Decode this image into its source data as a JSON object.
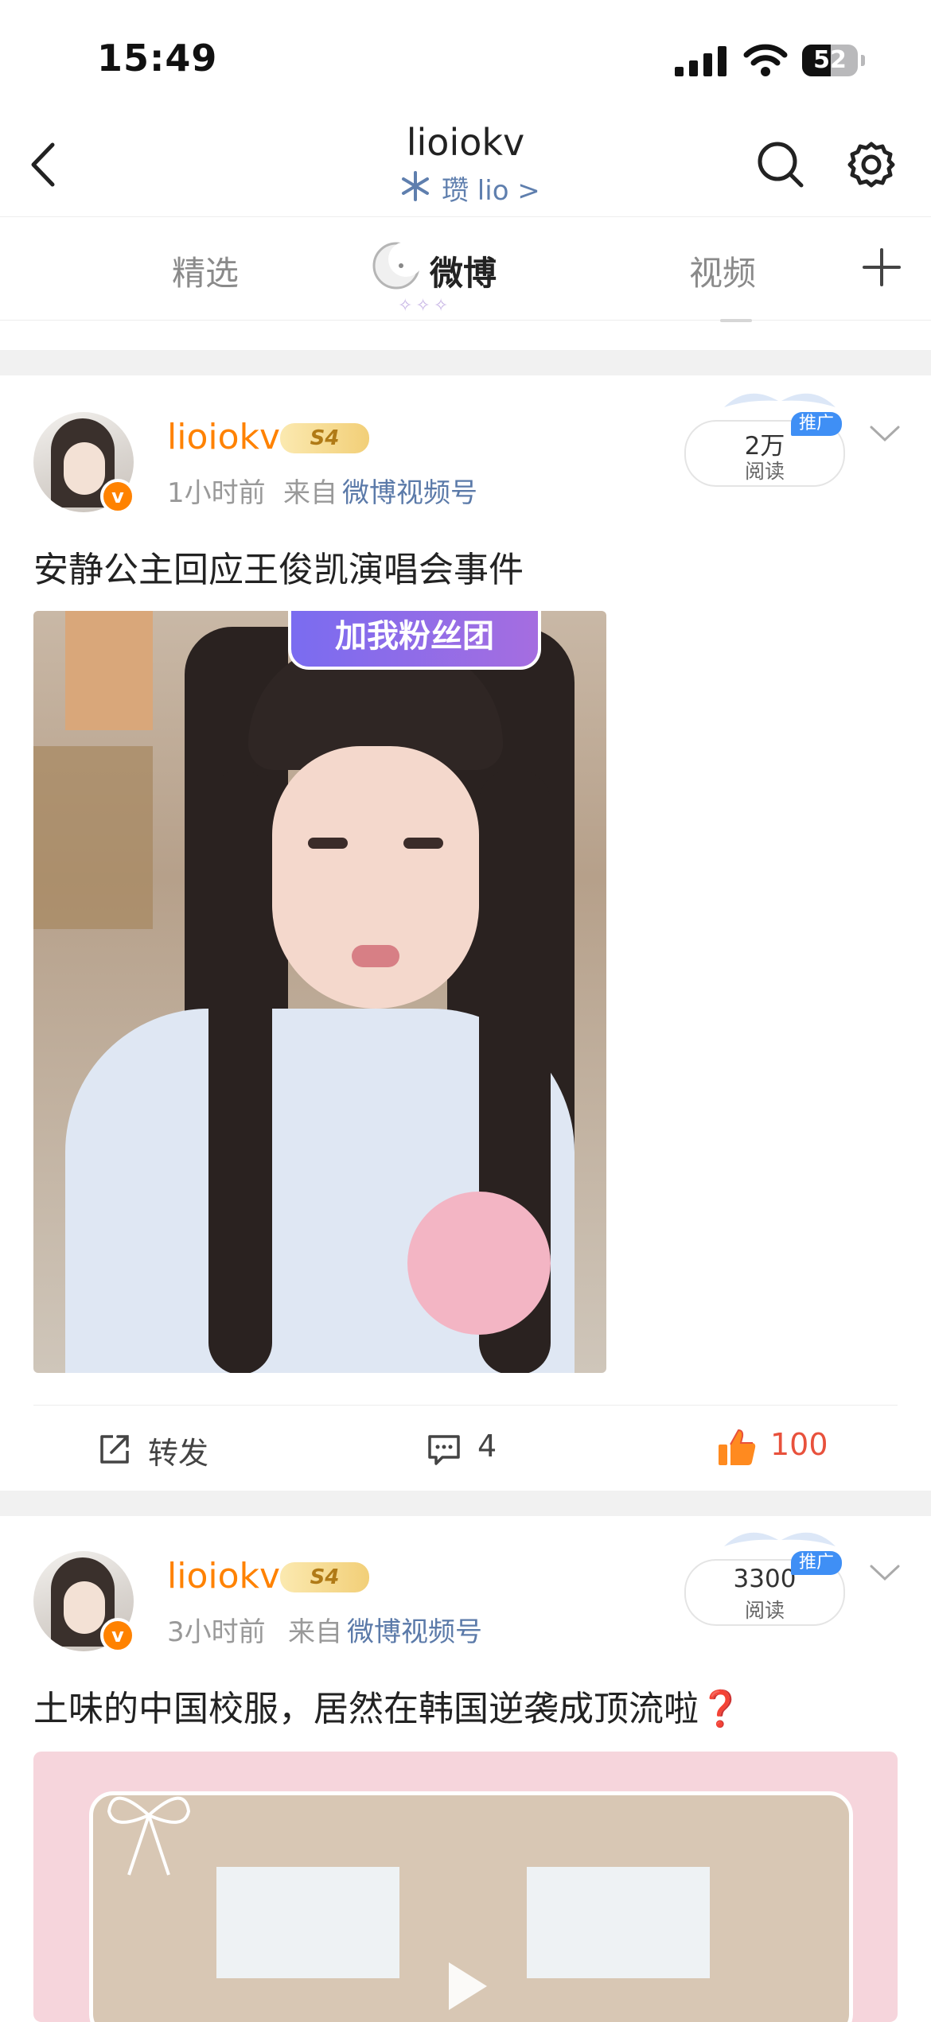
{
  "status_bar": {
    "time": "15:49",
    "battery": "52",
    "battery_level": 0.52
  },
  "header": {
    "title": "lioiokv",
    "subtitle": "瓒 lio >"
  },
  "tabs": [
    {
      "label": "精选",
      "active": false
    },
    {
      "label": "微博",
      "active": true
    },
    {
      "label": "视频",
      "active": false
    }
  ],
  "posts": [
    {
      "username": "lioiokv",
      "level_badge": "S4",
      "time": "1小时前",
      "source_prefix": "来自",
      "source_link": "微博视频号",
      "read_count": "2万",
      "read_label": "阅读",
      "promo_badge": "推广",
      "text": "安静公主回应王俊凯演唱会事件",
      "media_overlay_text": "加我粉丝团",
      "actions": {
        "repost": "转发",
        "comments": "4",
        "likes": "100"
      }
    },
    {
      "username": "lioiokv",
      "level_badge": "S4",
      "time": "3小时前",
      "source_prefix": "来自",
      "source_link": "微博视频号",
      "read_count": "3300",
      "read_label": "阅读",
      "promo_badge": "推广",
      "text": "土味的中国校服，居然在韩国逆袭成顶流啦",
      "text_emoji": "❓"
    }
  ],
  "colors": {
    "accent": "#ff8200",
    "link": "#5b7aa9",
    "like": "#e8513c",
    "promo": "#3f8ff5",
    "tab_active": "#222222"
  },
  "icons": [
    "back-arrow-icon",
    "search-icon",
    "gear-icon",
    "plus-icon",
    "snowflake-icon",
    "chevron-right-icon",
    "chevron-down-icon",
    "repost-icon",
    "comment-icon",
    "thumbs-up-icon",
    "play-icon",
    "wing-icon",
    "verified-icon"
  ]
}
